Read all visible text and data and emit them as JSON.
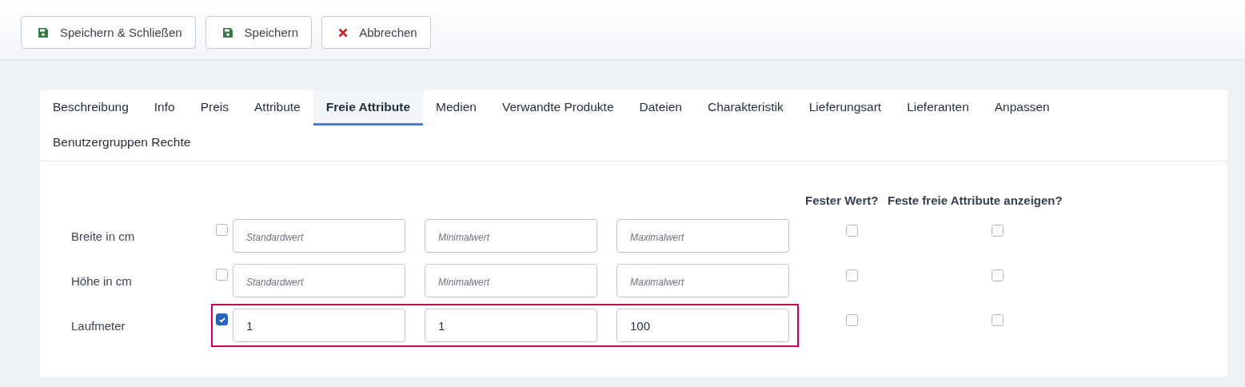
{
  "toolbar": [
    {
      "label": "Speichern & Schließen",
      "kind": "save"
    },
    {
      "label": "Speichern",
      "kind": "save"
    },
    {
      "label": "Abbrechen",
      "kind": "cancel"
    }
  ],
  "tabs": [
    {
      "label": "Beschreibung",
      "selected": false
    },
    {
      "label": "Info",
      "selected": false
    },
    {
      "label": "Preis",
      "selected": false
    },
    {
      "label": "Attribute",
      "selected": false
    },
    {
      "label": "Freie Attribute",
      "selected": true
    },
    {
      "label": "Medien",
      "selected": false
    },
    {
      "label": "Verwandte Produkte",
      "selected": false
    },
    {
      "label": "Dateien",
      "selected": false
    },
    {
      "label": "Charakteristik",
      "selected": false
    },
    {
      "label": "Lieferungsart",
      "selected": false
    },
    {
      "label": "Lieferanten",
      "selected": false
    },
    {
      "label": "Anpassen",
      "selected": false
    },
    {
      "label": "Benutzergruppen Rechte",
      "selected": false
    }
  ],
  "columns": {
    "fixed_value": "Fester Wert?",
    "show_fixed": "Feste freie Attribute anzeigen?"
  },
  "rows": [
    {
      "label": "Breite in cm",
      "checked": false,
      "highlighted": false,
      "fields": [
        {
          "placeholder": "Standardwert"
        },
        {
          "placeholder": "Minimalwert"
        },
        {
          "placeholder": "Maximalwert"
        }
      ],
      "fixed_value": false,
      "show_fixed": false
    },
    {
      "label": "Höhe in cm",
      "checked": false,
      "highlighted": false,
      "fields": [
        {
          "placeholder": "Standardwert"
        },
        {
          "placeholder": "Minimalwert"
        },
        {
          "placeholder": "Maximalwert"
        }
      ],
      "fixed_value": false,
      "show_fixed": false
    },
    {
      "label": "Laufmeter",
      "checked": true,
      "highlighted": true,
      "fields": [
        {
          "value": "1"
        },
        {
          "value": "1"
        },
        {
          "value": "100"
        }
      ],
      "fixed_value": false,
      "show_fixed": false
    }
  ]
}
